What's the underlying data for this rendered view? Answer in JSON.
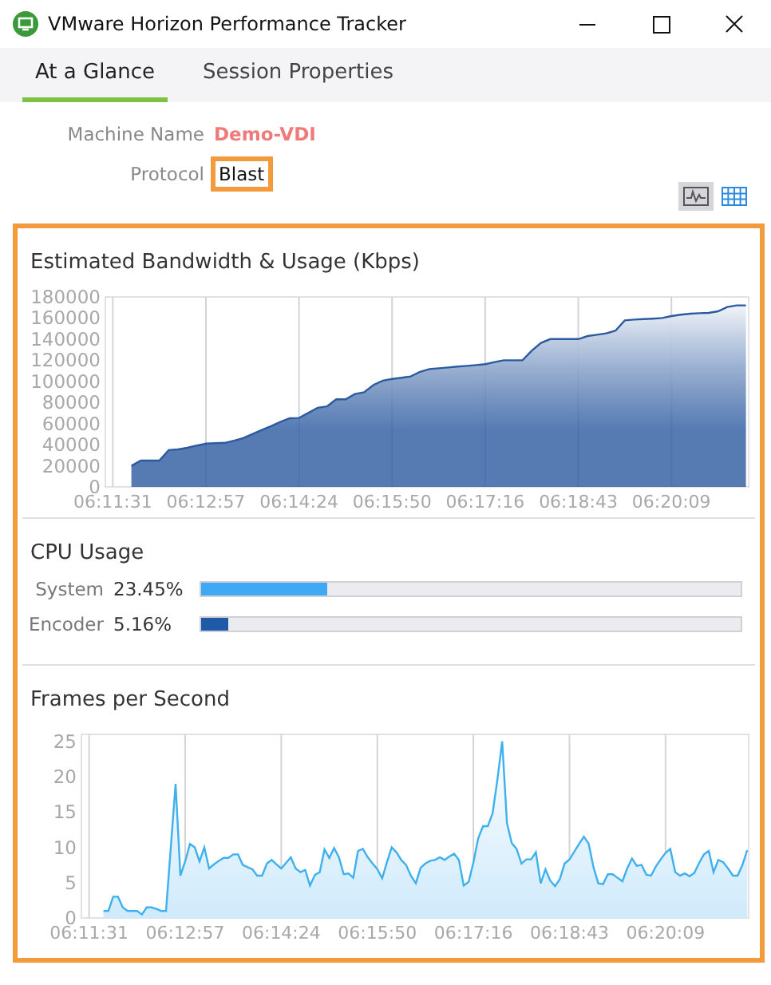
{
  "window": {
    "title": "VMware Horizon Performance Tracker"
  },
  "tabs": [
    {
      "label": "At a Glance",
      "selected": true
    },
    {
      "label": "Session Properties",
      "selected": false
    }
  ],
  "info": [
    {
      "label": "Machine Name",
      "value": "Demo-VDI",
      "kind": "accent",
      "highlighted": false
    },
    {
      "label": "Protocol",
      "value": "Blast",
      "kind": "plain",
      "highlighted": true
    }
  ],
  "view_buttons": [
    {
      "kind": "chart",
      "selected": true
    },
    {
      "kind": "table",
      "selected": false
    }
  ],
  "bandwidth": {
    "title": "Estimated Bandwidth & Usage (Kbps)",
    "chart_data": {
      "type": "area",
      "grid": true,
      "color": "#2c5aa0",
      "categories": [
        "06:11:31",
        null,
        null,
        null,
        null,
        null,
        null,
        null,
        null,
        null,
        "06:12:57",
        null,
        null,
        null,
        null,
        null,
        null,
        null,
        null,
        null,
        "06:14:24",
        null,
        null,
        null,
        null,
        null,
        null,
        null,
        null,
        null,
        "06:15:50",
        null,
        null,
        null,
        null,
        null,
        null,
        null,
        null,
        null,
        "06:17:16",
        null,
        null,
        null,
        null,
        null,
        null,
        null,
        null,
        null,
        "06:18:43",
        null,
        null,
        null,
        null,
        null,
        null,
        null,
        null,
        null,
        "06:20:09",
        null,
        null,
        null,
        null,
        null,
        null,
        null,
        null
      ],
      "values": [
        null,
        null,
        20000,
        25000,
        25000,
        25000,
        35000,
        35600,
        37000,
        39200,
        41000,
        41500,
        41800,
        43700,
        46300,
        50000,
        54000,
        57700,
        61600,
        65000,
        65300,
        70000,
        75000,
        76200,
        83000,
        83000,
        88000,
        89700,
        96600,
        100800,
        102300,
        103500,
        104600,
        109100,
        111600,
        112400,
        113200,
        114000,
        114700,
        115400,
        116300,
        118300,
        120000,
        120000,
        120000,
        129000,
        136500,
        140000,
        140000,
        140000,
        140000,
        142900,
        144100,
        145500,
        148100,
        157800,
        158500,
        159000,
        159500,
        160000,
        161800,
        163200,
        164100,
        164500,
        164800,
        166400,
        170500,
        172000,
        172000
      ],
      "ylim": [
        0,
        180000
      ],
      "yticks": [
        0,
        20000,
        40000,
        60000,
        80000,
        100000,
        120000,
        140000,
        160000,
        180000
      ]
    }
  },
  "cpu": {
    "title": "CPU Usage",
    "rows": [
      {
        "label": "System",
        "reading": "23.45%",
        "level": 0.2345,
        "color": "#3fa9f5"
      },
      {
        "label": "Encoder",
        "reading": "5.16%",
        "level": 0.0516,
        "color": "#1f5aa8"
      }
    ]
  },
  "fps": {
    "title": "Frames per Second",
    "chart_data": {
      "type": "area",
      "grid": true,
      "color": "#3fb0ee",
      "categories": [
        "06:11:31",
        null,
        null,
        null,
        null,
        null,
        null,
        null,
        null,
        null,
        null,
        null,
        null,
        null,
        null,
        null,
        null,
        null,
        null,
        null,
        "06:12:57",
        null,
        null,
        null,
        null,
        null,
        null,
        null,
        null,
        null,
        null,
        null,
        null,
        null,
        null,
        null,
        null,
        null,
        null,
        null,
        "06:14:24",
        null,
        null,
        null,
        null,
        null,
        null,
        null,
        null,
        null,
        null,
        null,
        null,
        null,
        null,
        null,
        null,
        null,
        null,
        null,
        "06:15:50",
        null,
        null,
        null,
        null,
        null,
        null,
        null,
        null,
        null,
        null,
        null,
        null,
        null,
        null,
        null,
        null,
        null,
        null,
        null,
        "06:17:16",
        null,
        null,
        null,
        null,
        null,
        null,
        null,
        null,
        null,
        null,
        null,
        null,
        null,
        null,
        null,
        null,
        null,
        null,
        null,
        "06:18:43",
        null,
        null,
        null,
        null,
        null,
        null,
        null,
        null,
        null,
        null,
        null,
        null,
        null,
        null,
        null,
        null,
        null,
        null,
        null,
        "06:20:09",
        null,
        null,
        null,
        null,
        null,
        null,
        null,
        null,
        null,
        null,
        null,
        null,
        null,
        null,
        null,
        null,
        null
      ],
      "values": [
        null,
        null,
        null,
        1,
        1,
        3,
        3,
        1.5,
        1,
        1,
        1,
        0.5,
        1.5,
        1.5,
        1.3,
        1,
        1,
        10,
        19,
        6,
        8,
        10.5,
        10,
        8,
        10,
        7,
        7.6,
        8.1,
        8.5,
        8.5,
        9,
        9,
        7.5,
        7.2,
        6.9,
        6,
        6,
        7.7,
        8.2,
        7.6,
        7,
        7.8,
        8.6,
        7,
        6.5,
        6.8,
        4.6,
        6.1,
        6.5,
        9.7,
        8.5,
        9.9,
        8.6,
        6.2,
        6.3,
        5.7,
        9.5,
        9.8,
        8.6,
        7.7,
        6.9,
        5.6,
        7.9,
        10,
        9.3,
        8.2,
        7.5,
        6,
        4.9,
        7.1,
        7.7,
        8.1,
        8.2,
        8.6,
        8.2,
        8.7,
        9.1,
        8.2,
        4.6,
        5.1,
        7.9,
        11.3,
        13,
        13,
        14.8,
        19.6,
        25,
        13.4,
        10.6,
        9.8,
        7.7,
        8.3,
        8.3,
        9.3,
        4.9,
        6.9,
        5.3,
        4.5,
        5.5,
        7.7,
        8.3,
        9.4,
        10.5,
        11.5,
        10.5,
        7.2,
        4.9,
        4.8,
        6.2,
        6.2,
        5.7,
        5.2,
        7,
        8.4,
        7.4,
        7.5,
        6.1,
        6,
        7.3,
        8.3,
        9.2,
        9.8,
        6.5,
        6,
        6.3,
        5.9,
        6.4,
        7.8,
        9,
        9.5,
        6.5,
        8.2,
        7.9,
        7,
        6,
        6,
        7.5,
        9.6
      ],
      "ylim": [
        0,
        26
      ],
      "yticks": [
        0,
        5,
        10,
        15,
        20,
        25
      ]
    }
  }
}
